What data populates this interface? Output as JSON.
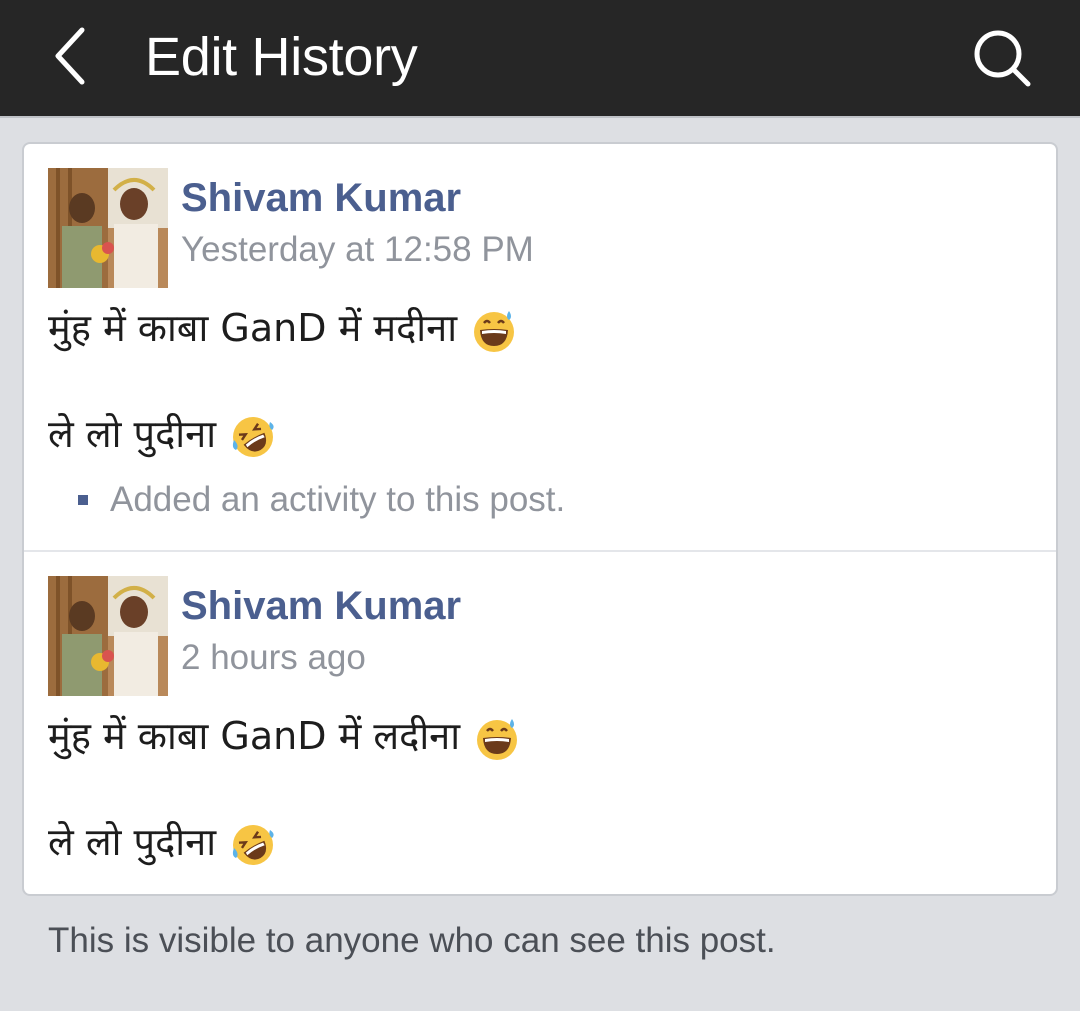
{
  "header": {
    "title": "Edit History",
    "back_icon": "chevron-left-icon",
    "search_icon": "search-icon"
  },
  "entries": [
    {
      "author": "Shivam Kumar",
      "timestamp": "Yesterday at 12:58 PM",
      "line1": "मुंह में काबा GanD में मदीना",
      "line1_emoji": "grinning-sweat-emoji",
      "line2": "ले लो पुदीना",
      "line2_emoji": "rolling-on-floor-laughing-emoji",
      "note": "Added an activity to this post."
    },
    {
      "author": "Shivam Kumar",
      "timestamp": "2 hours ago",
      "line1": "मुंह में काबा GanD में लदीना",
      "line1_emoji": "grinning-sweat-emoji",
      "line2": "ले लो पुदीना",
      "line2_emoji": "rolling-on-floor-laughing-emoji"
    }
  ],
  "footer": {
    "text": "This is visible to anyone who can see this post."
  },
  "colors": {
    "topbar": "#262626",
    "author_link": "#4b5f8f",
    "muted": "#90949c",
    "background": "#dddfe3"
  }
}
